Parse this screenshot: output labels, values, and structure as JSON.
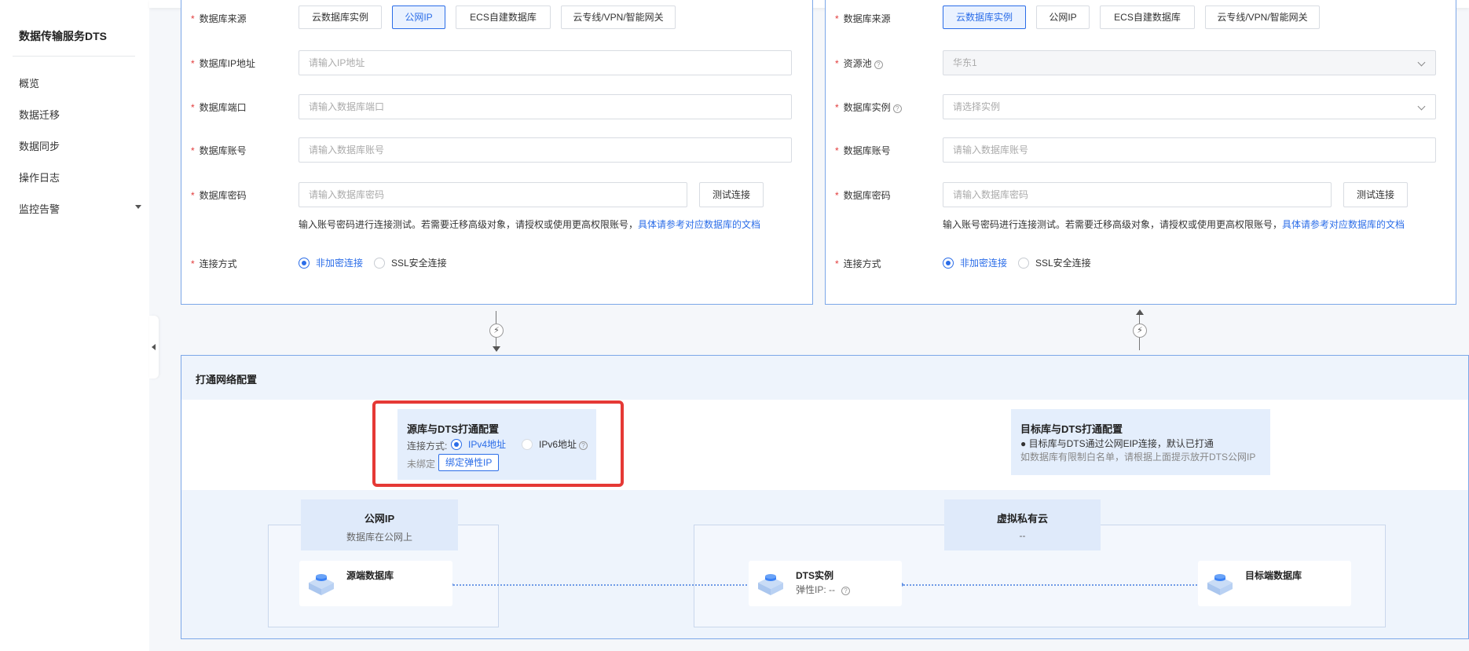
{
  "sidebar": {
    "title": "数据传输服务DTS",
    "items": [
      {
        "label": "概览"
      },
      {
        "label": "数据迁移"
      },
      {
        "label": "数据同步"
      },
      {
        "label": "操作日志"
      },
      {
        "label": "监控告警"
      }
    ]
  },
  "source": {
    "db_source_label": "数据库来源",
    "db_source_options": [
      "云数据库实例",
      "公网IP",
      "ECS自建数据库",
      "云专线/VPN/智能网关"
    ],
    "db_source_selected": "公网IP",
    "ip_label": "数据库IP地址",
    "ip_placeholder": "请输入IP地址",
    "port_label": "数据库端口",
    "port_placeholder": "请输入数据库端口",
    "account_label": "数据库账号",
    "account_placeholder": "请输入数据库账号",
    "password_label": "数据库密码",
    "password_placeholder": "请输入数据库密码",
    "test_button": "测试连接",
    "hint": "输入账号密码进行连接测试。若需要迁移高级对象，请授权或使用更高权限账号，",
    "hint_link": "具体请参考对应数据库的文档",
    "conn_label": "连接方式",
    "conn_options": [
      "非加密连接",
      "SSL安全连接"
    ],
    "conn_selected": "非加密连接"
  },
  "target": {
    "db_source_label": "数据库来源",
    "db_source_options": [
      "云数据库实例",
      "公网IP",
      "ECS自建数据库",
      "云专线/VPN/智能网关"
    ],
    "db_source_selected": "云数据库实例",
    "pool_label": "资源池",
    "pool_value": "华东1",
    "instance_label": "数据库实例",
    "instance_placeholder": "请选择实例",
    "account_label": "数据库账号",
    "account_placeholder": "请输入数据库账号",
    "password_label": "数据库密码",
    "password_placeholder": "请输入数据库密码",
    "test_button": "测试连接",
    "hint": "输入账号密码进行连接测试。若需要迁移高级对象，请授权或使用更高权限账号，",
    "hint_link": "具体请参考对应数据库的文档",
    "conn_label": "连接方式",
    "conn_options": [
      "非加密连接",
      "SSL安全连接"
    ],
    "conn_selected": "非加密连接"
  },
  "network": {
    "title": "打通网络配置",
    "source_cfg": {
      "title": "源库与DTS打通配置",
      "conn_label": "连接方式:",
      "options": [
        "IPv4地址",
        "IPv6地址"
      ],
      "selected": "IPv4地址",
      "unbound_label": "未绑定",
      "bind_button": "绑定弹性IP"
    },
    "target_cfg": {
      "title": "目标库与DTS打通配置",
      "line1": "● 目标库与DTS通过公网EIP连接，默认已打通",
      "line2": "如数据库有限制白名单，请根据上面提示放开DTS公网IP"
    },
    "public_group": {
      "title": "公网IP",
      "subtitle": "数据库在公网上"
    },
    "vpc_group": {
      "title": "虚拟私有云",
      "subtitle": "--"
    },
    "nodes": {
      "source_db": "源端数据库",
      "dts_instance": "DTS实例",
      "dts_eip": "弹性IP: --",
      "target_db": "目标端数据库"
    }
  },
  "colors": {
    "accent": "#2b6de8",
    "highlight": "#e53935",
    "required": "#e23b3b"
  }
}
